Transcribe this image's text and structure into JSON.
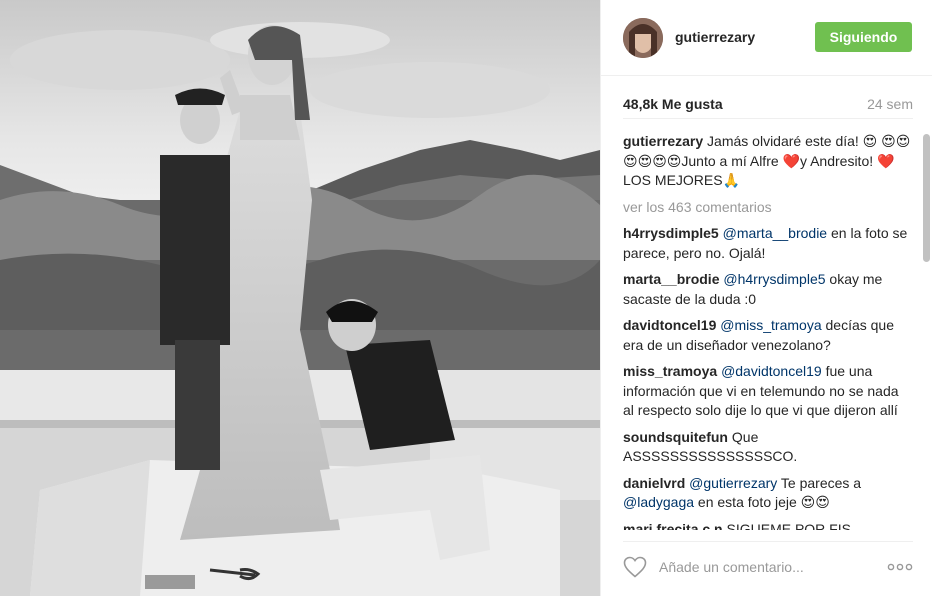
{
  "post": {
    "author": "gutierrezary",
    "follow_label": "Siguiendo",
    "likes": "48,8k Me gusta",
    "age": "24 sem",
    "view_all": "ver los 463 comentarios",
    "comment_placeholder": "Añade un comentario..."
  },
  "caption": {
    "user": "gutierrezary",
    "text_1": " Jamás olvidaré este día! 😍 😍😍😍😍😍😍Junto a mí Alfre ❤️y Andresito! ❤️LOS MEJORES🙏"
  },
  "comments": [
    {
      "user": "h4rrysdimple5",
      "mention": "@marta__brodie",
      "text": " en la foto se parece, pero no. Ojalá!"
    },
    {
      "user": "marta__brodie",
      "mention": "@h4rrysdimple5",
      "text": " okay me sacaste de la duda :0"
    },
    {
      "user": "davidtoncel19",
      "mention": "@miss_tramoya",
      "text": " decías que era de un diseñador venezolano?"
    },
    {
      "user": "miss_tramoya",
      "mention": "@davidtoncel19",
      "text": " fue una información que vi en telemundo no se nada al respecto solo dije lo que vi que dijeron allí"
    },
    {
      "user": "soundsquitefun",
      "mention": "",
      "text": " Que ASSSSSSSSSSSSSSSCO."
    },
    {
      "user": "danielvrd",
      "mention": "@gutierrezary",
      "text": " Te pareces a ",
      "mention2": "@ladygaga",
      "text2": " en esta foto jeje 😍😍"
    },
    {
      "user": "mari.frecita.c.n",
      "mention": "",
      "text": " SIGUEME POR FIS"
    }
  ],
  "icons": {
    "heart": "heart-icon",
    "more": "more-options-icon",
    "avatar": "avatar"
  },
  "colors": {
    "follow_button": "#70c050",
    "mention": "#003569",
    "muted": "#999999"
  }
}
